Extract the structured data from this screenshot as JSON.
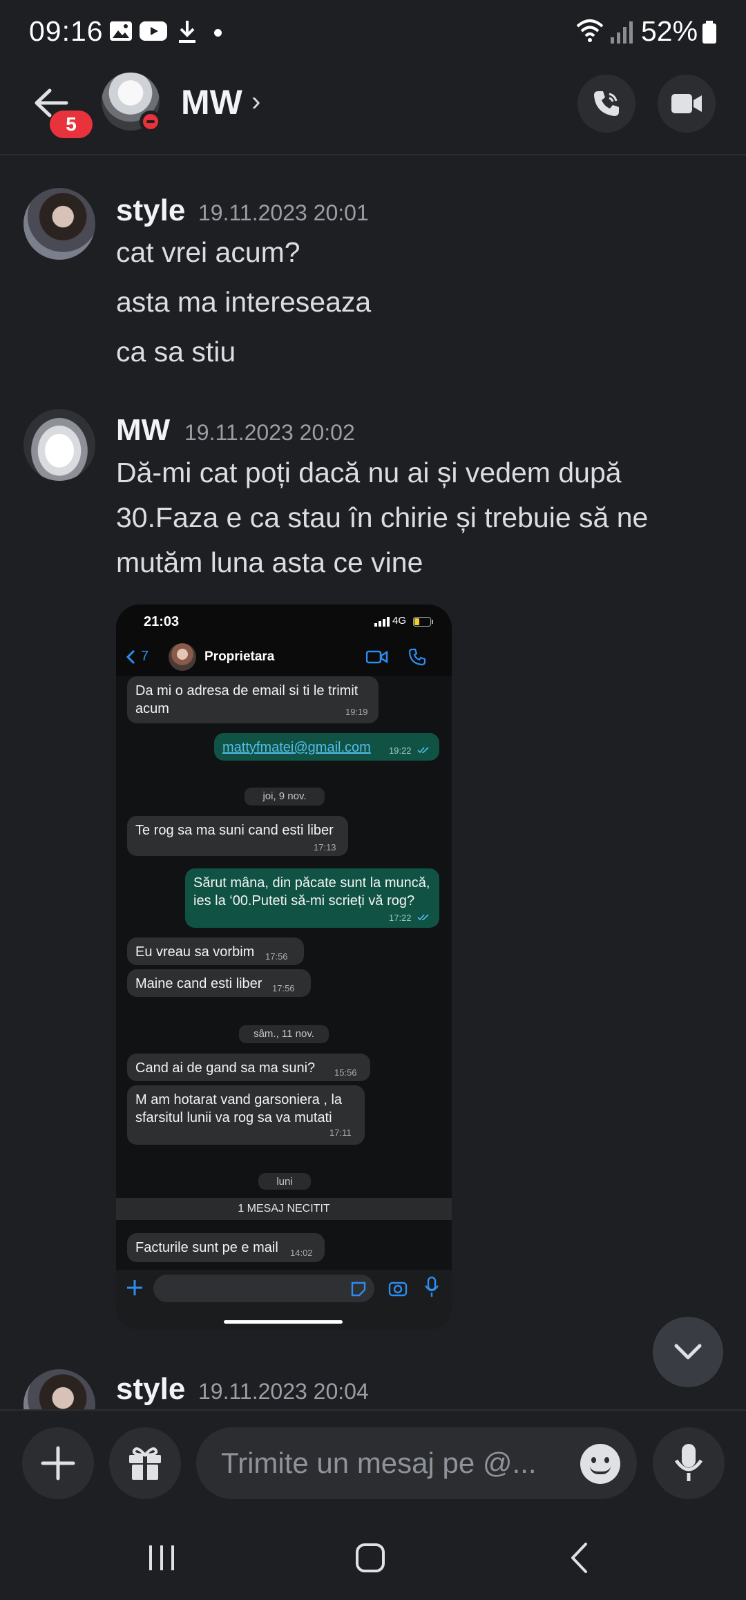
{
  "status_bar": {
    "time": "09:16",
    "battery": "52%"
  },
  "header": {
    "unread_badge": "5",
    "contact_name": "MW",
    "name_chevron": "›"
  },
  "messages": [
    {
      "author": "style",
      "timestamp": "19.11.2023 20:01",
      "lines": [
        "cat vrei acum?",
        "asta ma intereseaza",
        "ca sa stiu"
      ]
    },
    {
      "author": "MW",
      "timestamp": "19.11.2023 20:02",
      "lines": [
        "Dă-mi cat poți dacă nu ai și vedem după",
        "30.Faza e ca stau în chirie și trebuie să ne",
        "mutăm luna asta ce vine"
      ]
    },
    {
      "author": "style",
      "timestamp": "19.11.2023 20:04"
    }
  ],
  "attachment": {
    "status_time": "21:03",
    "network": "4G",
    "back_count": "7",
    "contact": "Proprietara",
    "bubbles": [
      {
        "text": "Da mi o adresa de email si ti le trimit acum",
        "time": "19:19"
      },
      {
        "text": "mattyfmatei@gmail.com",
        "time": "19:22"
      },
      {
        "text": "Te rog sa ma suni cand esti liber",
        "time": "17:13"
      },
      {
        "text": "Sărut mâna, din păcate sunt la muncă, ies la ‘00.Puteti să-mi scrieți vă rog?",
        "time": "17:22"
      },
      {
        "text": "Eu vreau sa vorbim",
        "time": "17:56"
      },
      {
        "text": "Maine cand esti liber",
        "time": "17:56"
      },
      {
        "text": "Cand ai de gand sa ma suni?",
        "time": "15:56"
      },
      {
        "text": "M am hotarat vand garsoniera , la sfarsitul lunii va rog sa va mutati",
        "time": "17:11"
      },
      {
        "text": "Facturile sunt pe e mail",
        "time": "14:02"
      }
    ],
    "date_pills": [
      "joi, 9 nov.",
      "sâm., 11 nov.",
      "luni"
    ],
    "unread_banner": "1 MESAJ NECITIT"
  },
  "composer": {
    "placeholder": "Trimite un mesaj pe @..."
  },
  "colors": {
    "background": "#1e1f23",
    "badge": "#e9333c",
    "wa_outgoing": "#105244",
    "wa_accent": "#2b8ef0"
  }
}
